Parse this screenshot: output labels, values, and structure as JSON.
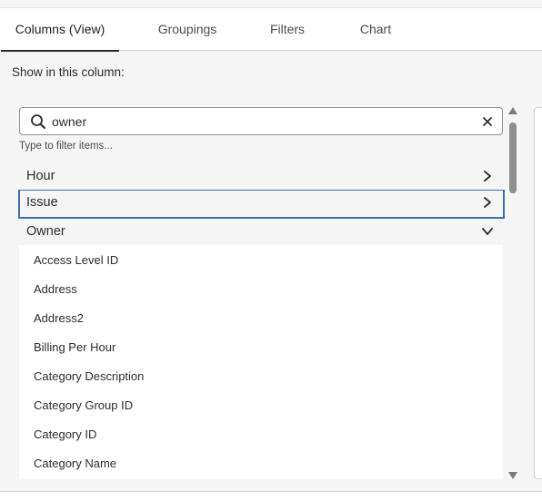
{
  "tabs": [
    {
      "label": "Columns (View)",
      "active": true
    },
    {
      "label": "Groupings",
      "active": false
    },
    {
      "label": "Filters",
      "active": false
    },
    {
      "label": "Chart",
      "active": false
    }
  ],
  "section_label": "Show in this column:",
  "search": {
    "value": "owner",
    "hint": "Type to filter items...",
    "search_icon": "search-icon",
    "clear_icon": "close-icon"
  },
  "groups": [
    {
      "label": "Hour",
      "expanded": false,
      "icon": "chevron-right-icon"
    },
    {
      "label": "Issue",
      "expanded": false,
      "focused": true,
      "icon": "chevron-right-icon"
    },
    {
      "label": "Owner",
      "expanded": true,
      "icon": "chevron-down-icon"
    }
  ],
  "owner_items": [
    "Access Level ID",
    "Address",
    "Address2",
    "Billing Per Hour",
    "Category Description",
    "Category Group ID",
    "Category ID",
    "Category Name"
  ],
  "colors": {
    "focus_border": "#3b6fb1",
    "active_tab_underline": "#2c2c2c",
    "panel_bg": "#f5f5f5"
  }
}
